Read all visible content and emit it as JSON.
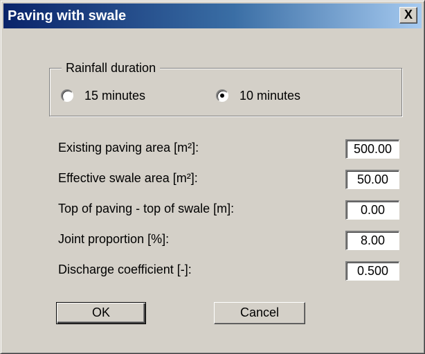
{
  "window": {
    "title": "Paving with swale",
    "close_label": "X"
  },
  "rainfall": {
    "legend": "Rainfall duration",
    "options": [
      {
        "label": "15 minutes",
        "selected": false
      },
      {
        "label": "10 minutes",
        "selected": true
      }
    ]
  },
  "fields": [
    {
      "label": "Existing paving area [m²]:",
      "value": "500.00"
    },
    {
      "label": "Effective swale area [m²]:",
      "value": "50.00"
    },
    {
      "label": "Top of paving - top of swale [m]:",
      "value": "0.00"
    },
    {
      "label": "Joint proportion [%]:",
      "value": "8.00"
    },
    {
      "label": "Discharge coefficient [-]:",
      "value": "0.500"
    }
  ],
  "buttons": {
    "ok_label": "OK",
    "cancel_label": "Cancel"
  },
  "colors": {
    "titlebar_start": "#0a246a",
    "titlebar_end": "#a6caf0",
    "dialog_face": "#d4d0c8"
  }
}
